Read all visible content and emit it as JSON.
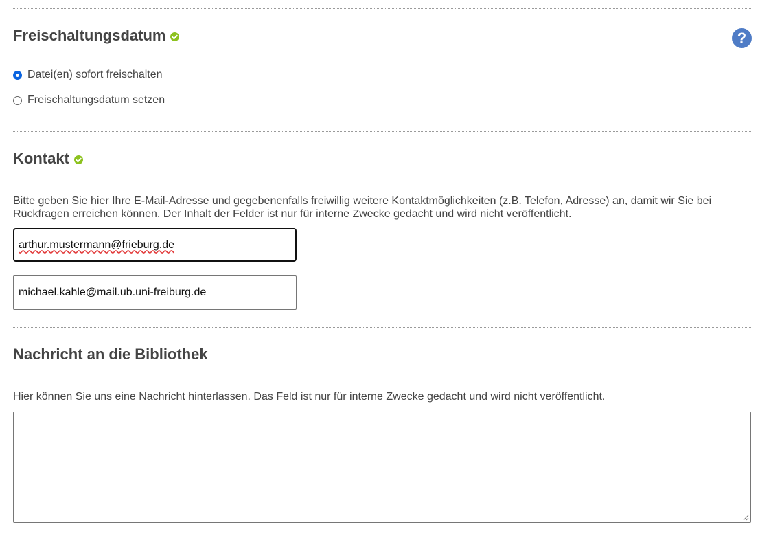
{
  "release": {
    "title": "Freischaltungsdatum",
    "help_glyph": "?",
    "options": [
      {
        "label": "Datei(en) sofort freischalten",
        "checked": true
      },
      {
        "label": "Freischaltungsdatum setzen",
        "checked": false
      }
    ]
  },
  "contact": {
    "title": "Kontakt",
    "description": "Bitte geben Sie hier Ihre E-Mail-Adresse und gegebenenfalls freiwillig weitere Kontaktmöglichkeiten (z.B. Telefon, Adresse) an, damit wir Sie bei Rückfragen erreichen können. Der Inhalt der Felder ist nur für interne Zwecke gedacht und wird nicht veröffentlicht.",
    "email_primary": "arthur.mustermann@frieburg.de",
    "email_secondary": "michael.kahle@mail.ub.uni-freiburg.de"
  },
  "message": {
    "title": "Nachricht an die Bibliothek",
    "description": "Hier können Sie uns eine Nachricht hinterlassen. Das Feld ist nur für interne Zwecke gedacht und wird nicht veröffentlicht.",
    "value": ""
  },
  "colors": {
    "check_green": "#8dc21f",
    "help_blue": "#4f7cc6",
    "radio_blue": "#0a64e0"
  },
  "icons": {
    "status": "check-circle-icon",
    "help": "question-circle-icon"
  }
}
